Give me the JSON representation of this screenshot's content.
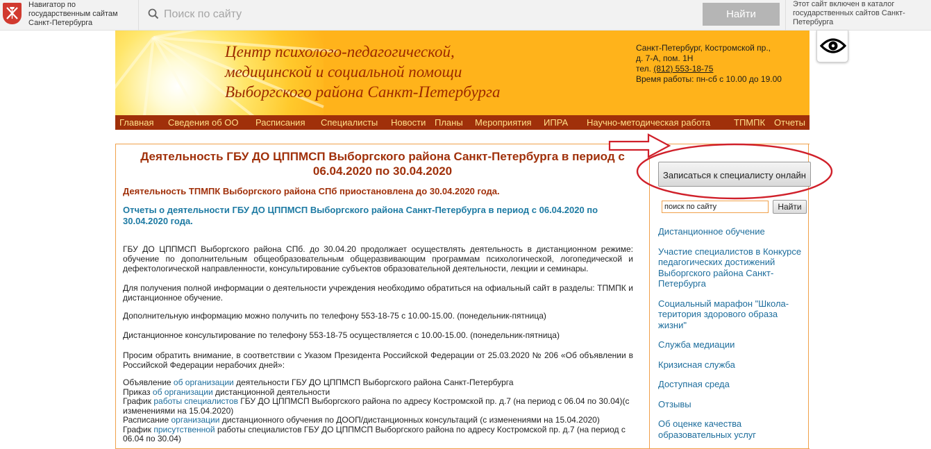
{
  "topbar": {
    "logo_icon": "spb-emblem-icon",
    "logo_text": "Навигатор по государственным сайтам Санкт-Петербурга",
    "search_placeholder": "Поиск по сайту",
    "search_button": "Найти",
    "catalog_text": "Этот сайт включен в каталог государственных сайтов Санкт-Петербурга"
  },
  "accessibility": {
    "icon": "eye-icon"
  },
  "header": {
    "title_lines": [
      "Центр психолого-педагогической,",
      "медицинской и социальной помощи",
      "Выборгского района Санкт-Петербурга"
    ],
    "address_line1": "Санкт-Петербург, Костромской пр.,",
    "address_line2": "д. 7-А, пом. 1Н",
    "phone_label": "тел.",
    "phone": "(812) 553-18-75",
    "hours": "Время работы: пн-сб с 10.00 до 19.00"
  },
  "menu": {
    "items": [
      "Главная",
      "Сведения об ОО",
      "Расписания",
      "Специалисты",
      "Новости",
      "Планы",
      "Мероприятия",
      "ИПРА",
      "Научно-методическая работа",
      "ТПМПК",
      "Отчеты"
    ]
  },
  "article": {
    "title": "Деятельность ГБУ ДО ЦППМСП Выборгского района Санкт-Петербурга в период с 06.04.2020 по 30.04.2020",
    "notice": "Деятельность ТПМПК Выборгского района СПб приостановлена до 30.04.2020 года.",
    "reports_link": "Отчеты о деятельности ГБУ ДО ЦППМСП Выборгского района Санкт-Петербурга в период с 06.04.2020 по 30.04.2020 года.",
    "p1": "ГБУ ДО ЦППМСП Выборгского района СПб. до 30.04.20 продолжает осуществлять деятельность в дистанционном режиме: обучение по дополнительным общеобразовательным общеразвивающим программам психологической, логопедической и дефектологической направленности, консультирование субъектов образовательной деятельности, лекции и семинары.",
    "p2": "Для получения полной информации о деятельности учреждения необходимо обратиться на офиальный сайт в разделы: ТПМПК и дистанционное обучение.",
    "p3": "Дополнительную информацию можно получить по телефону 553-18-75 с 10.00-15.00. (понедельник-пятница)",
    "p4": "Дистанционное консультирование по телефону 553-18-75 осуществляется с 10.00-15.00. (понедельник-пятница)",
    "p5": "Просим обратить внимание, в соответствии с Указом Президента Российской Федерации от 25.03.2020 № 206 «Об объявлении в Российской Федерации нерабочих дней»:",
    "docs": [
      {
        "pre": "Объявление ",
        "link": "об организации",
        "post": " деятельности ГБУ ДО ЦППМСП Выборгского района Санкт-Петербурга"
      },
      {
        "pre": "Приказ ",
        "link": "об организации",
        "post": " дистанционной деятельности"
      },
      {
        "pre": "График ",
        "link": "работы специалистов",
        "post": " ГБУ ДО ЦППМСП Выборгского района по адресу Костромской пр. д.7 (на период с 06.04 по 30.04)(с изменениями на 15.04.2020)"
      },
      {
        "pre": "Расписание ",
        "link": "организации",
        "post": " дистанционного обучения по ДООП/дистанционных консультаций (с изменениями на 15.04.2020)"
      },
      {
        "pre": "График ",
        "link": "присутственной",
        "post": " работы специалистов ГБУ ДО ЦППМСП Выборгского района по адресу Костромской пр. д.7 (на период с 06.04 по 30.04)"
      }
    ]
  },
  "sidebar": {
    "signup_button": "Записаться к специалисту онлайн",
    "search_value": "поиск по сайту",
    "search_button": "Найти",
    "links": [
      "Дистанционное обучение",
      "Участие специалистов в Конкурсе педагогических достижений Выборгского района Санкт-Петербурга",
      "Социальный марафон \"Школа-територия здорового образа жизни\"",
      "Служба медиации",
      "Кризисная служба",
      "Доступная среда",
      "Отзывы",
      "Об оценке качества образовательных услуг"
    ]
  },
  "colors": {
    "banner": "#ffb31b",
    "menu_bg": "#a0300a",
    "menu_text": "#ffe08a",
    "title": "#a0300a",
    "link": "#1d6d9c",
    "annotation": "#d0202a"
  }
}
